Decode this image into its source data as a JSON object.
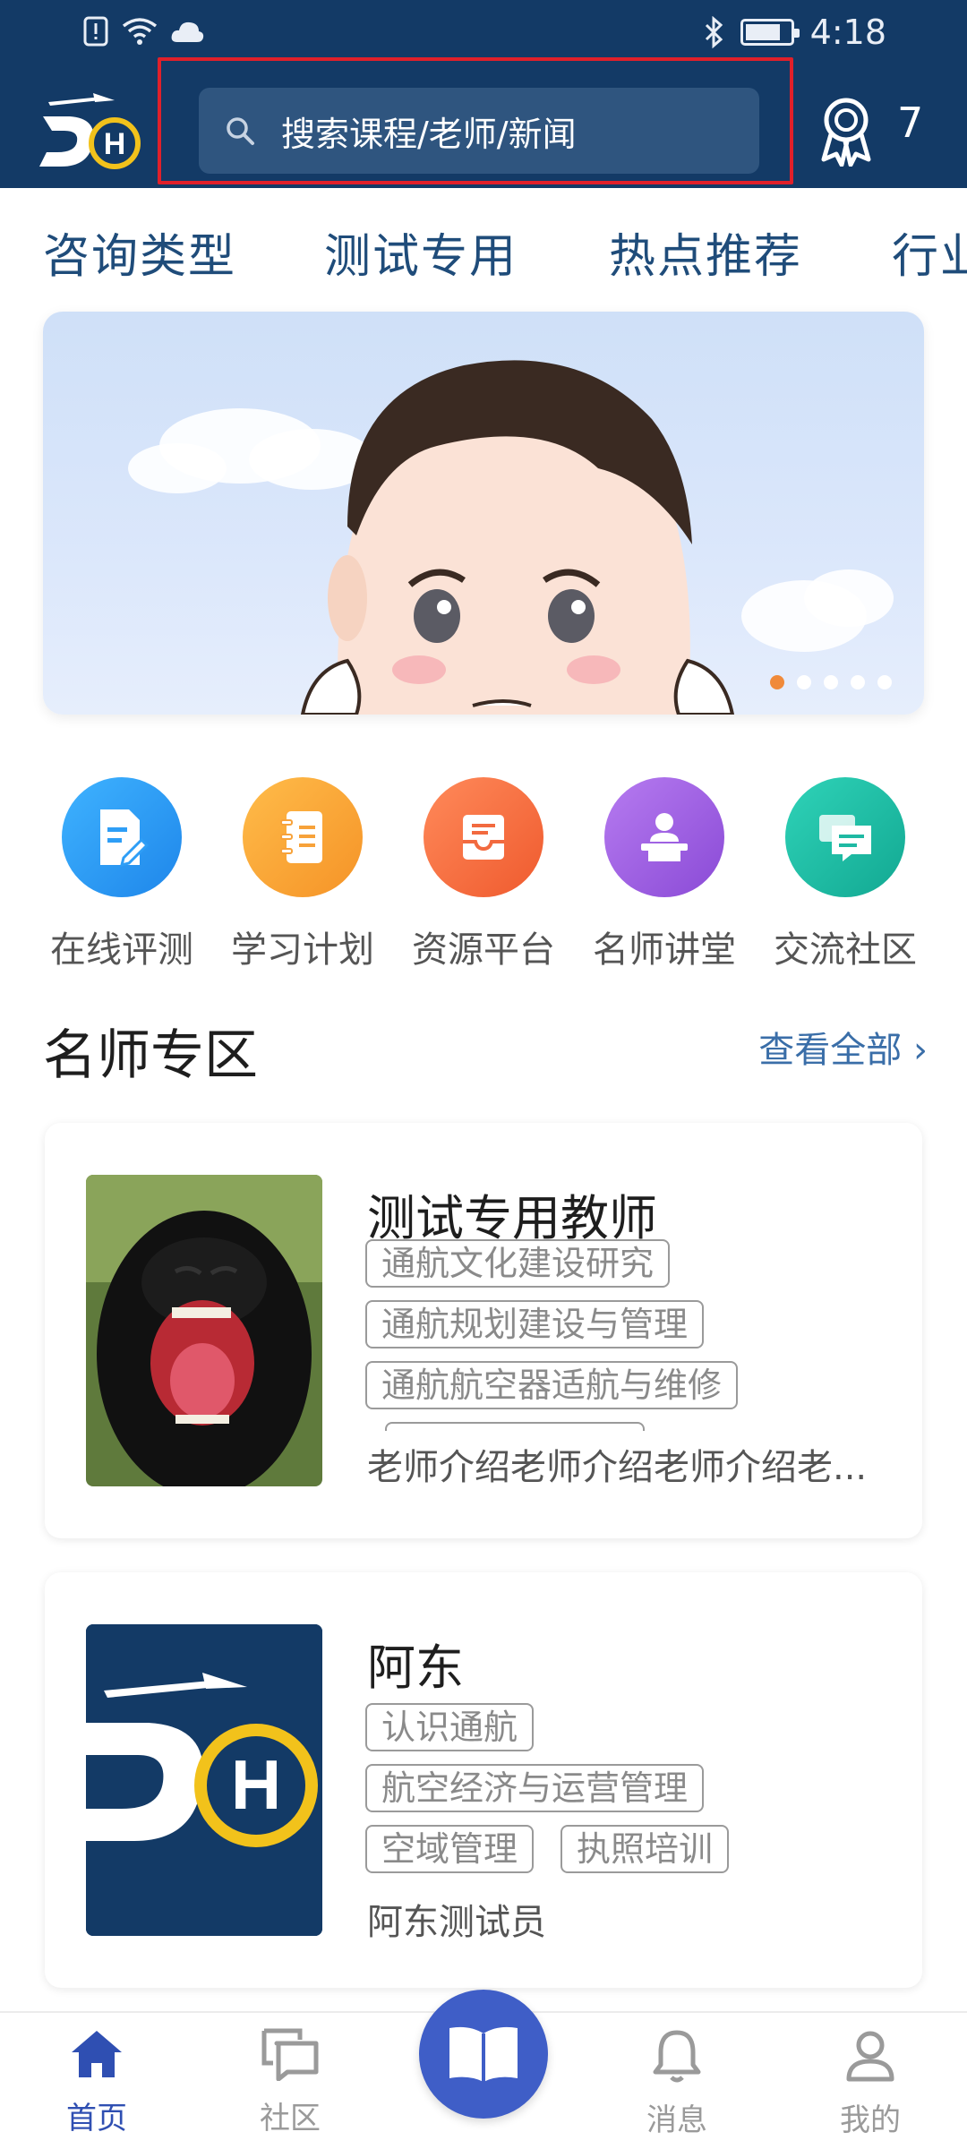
{
  "status_bar": {
    "time": "4:18"
  },
  "header": {
    "search_placeholder": "搜索课程/老师/新闻",
    "award_count": "7"
  },
  "categories": [
    "咨询类型",
    "测试专用",
    "热点推荐",
    "行业"
  ],
  "banner": {
    "active_index": 0,
    "dot_count": 5
  },
  "quick_actions": [
    {
      "label": "在线评测",
      "icon": "document-edit-icon",
      "color": "#2e9ef6"
    },
    {
      "label": "学习计划",
      "icon": "notebook-icon",
      "color": "#f7a23a"
    },
    {
      "label": "资源平台",
      "icon": "inbox-icon",
      "color": "#f26a3f"
    },
    {
      "label": "名师讲堂",
      "icon": "lecturer-icon",
      "color": "#9b5de0"
    },
    {
      "label": "交流社区",
      "icon": "chat-icon",
      "color": "#1fb9a3"
    }
  ],
  "teacher_section": {
    "title": "名师专区",
    "more": "查看全部 ›"
  },
  "teachers": [
    {
      "name": "测试专用教师",
      "tags": [
        "通航文化建设研究",
        "通航规划建设与管理",
        "通航航空器适航与维修"
      ],
      "intro": "老师介绍老师介绍老师介绍老..."
    },
    {
      "name": "阿东",
      "tags": [
        "认识通航",
        "航空经济与运营管理",
        "空域管理",
        "执照培训"
      ],
      "intro": "阿东测试员"
    }
  ],
  "bottom_nav": [
    {
      "label": "首页",
      "active": true
    },
    {
      "label": "社区",
      "active": false
    },
    {
      "label": "消息",
      "active": false
    },
    {
      "label": "我的",
      "active": false
    }
  ],
  "colors": {
    "brand": "#133a66",
    "accent": "#3f5ec7",
    "highlight": "#e0202a"
  }
}
